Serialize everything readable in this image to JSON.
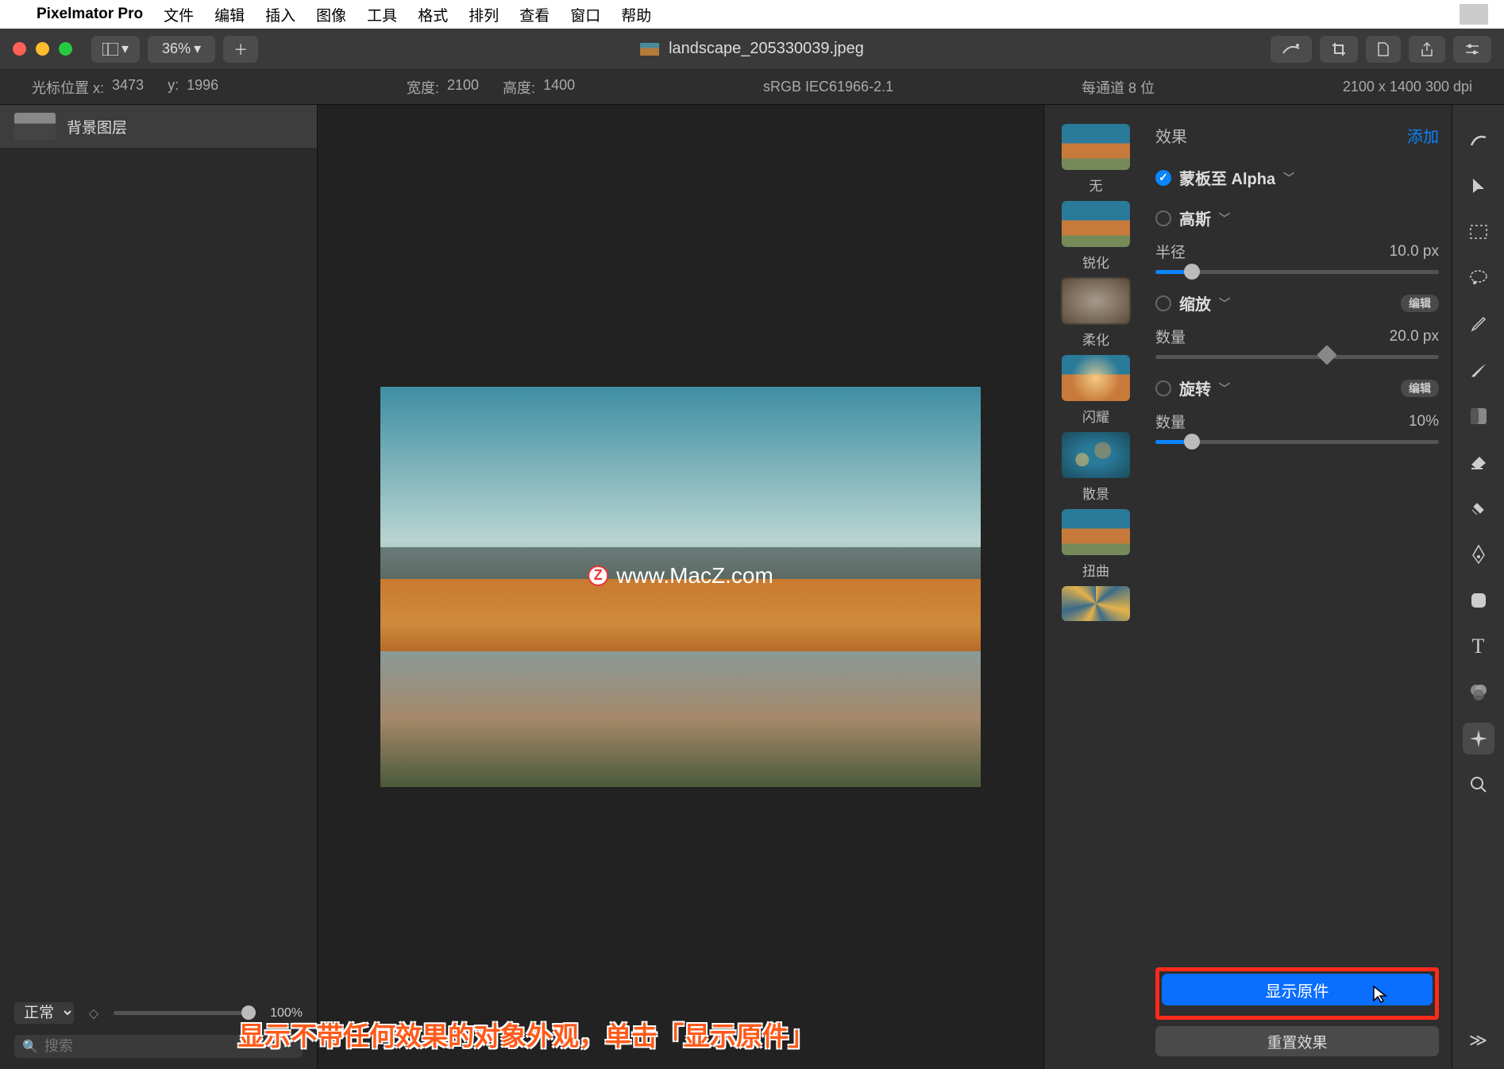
{
  "menubar": {
    "app": "Pixelmator Pro",
    "items": [
      "文件",
      "编辑",
      "插入",
      "图像",
      "工具",
      "格式",
      "排列",
      "查看",
      "窗口",
      "帮助"
    ]
  },
  "titlebar": {
    "zoom": "36%",
    "filename": "landscape_205330039.jpeg"
  },
  "infobar": {
    "cursor_label": "光标位置 x:",
    "cursor_x": "3473",
    "cursor_y_label": "y:",
    "cursor_y": "1996",
    "width_label": "宽度:",
    "width": "2100",
    "height_label": "高度:",
    "height": "1400",
    "colorspace": "sRGB IEC61966-2.1",
    "bitdepth": "每通道 8 位",
    "dimensions": "2100 x 1400 300 dpi"
  },
  "layers": {
    "item0": "背景图层",
    "blend_mode": "正常",
    "opacity": "100%",
    "search_placeholder": "搜索"
  },
  "canvas": {
    "watermark": "www.MacZ.com"
  },
  "effects": {
    "header": "效果",
    "add": "添加",
    "thumbs": {
      "none": "无",
      "sharpen": "锐化",
      "soften": "柔化",
      "flare": "闪耀",
      "bokeh": "散景",
      "distort": "扭曲"
    },
    "mask_alpha": "蒙板至 Alpha",
    "gaussian": "高斯",
    "radius_label": "半径",
    "radius_value": "10.0 px",
    "zoom": "缩放",
    "zoom_edit": "编辑",
    "amount_label": "数量",
    "amount_value": "20.0 px",
    "rotate": "旋转",
    "rotate_edit": "编辑",
    "rotate_amount_label": "数量",
    "rotate_amount_value": "10%",
    "show_original": "显示原件",
    "reset": "重置效果"
  },
  "annotation": "显示不带任何效果的对象外观，单击「显示原件」"
}
